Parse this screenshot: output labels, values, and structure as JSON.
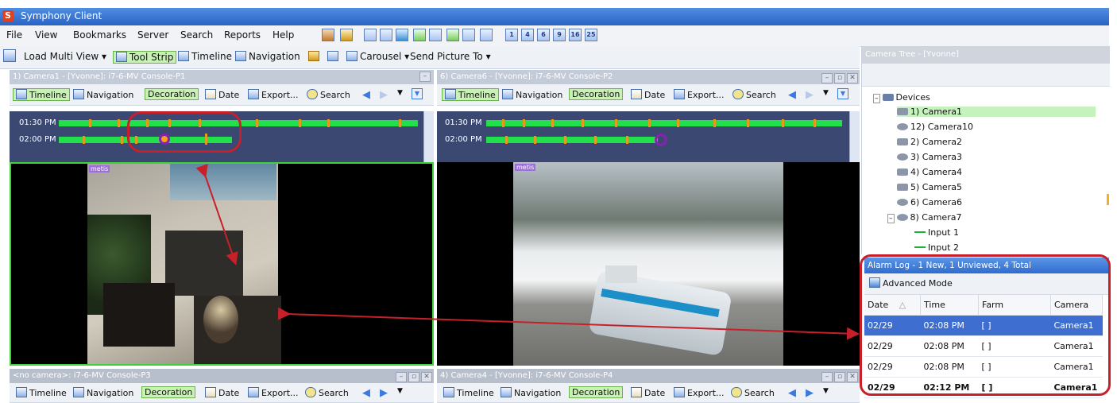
{
  "app": {
    "title": "Symphony Client",
    "logo_letter": "S"
  },
  "menu": [
    "File",
    "View",
    "Bookmarks",
    "Server",
    "Search",
    "Reports",
    "Help"
  ],
  "toolbar_numbers": [
    "1",
    "4",
    "6",
    "9",
    "16",
    "25"
  ],
  "toolbar": {
    "load_multi_view": "Load Multi View ▾",
    "tool_strip": "Tool Strip",
    "timeline": "Timeline",
    "navigation": "Navigation",
    "carousel": "Carousel ▾",
    "send_picture": "Send Picture To ▾"
  },
  "panes": {
    "p1": {
      "title": "1) Camera1 - [Yvonne]: i7-6-MV Console-P1",
      "watermark": "metis"
    },
    "p2": {
      "title": "6) Camera6 - [Yvonne]: i7-6-MV Console-P2",
      "watermark": "metis"
    },
    "p3": {
      "title": "<no camera>: i7-6-MV Console-P3"
    },
    "p4": {
      "title": "4) Camera4 - [Yvonne]: i7-6-MV Console-P4"
    }
  },
  "pane_tools": {
    "timeline": "Timeline",
    "navigation": "Navigation",
    "decoration": "Decoration",
    "date": "Date",
    "export": "Export...",
    "search": "Search"
  },
  "timeline_rows": [
    "01:30 PM",
    "02:00 PM"
  ],
  "camera_tree": {
    "header": "Camera Tree - [Yvonne]",
    "root": "Devices",
    "items": [
      "1) Camera1",
      "12) Camera10",
      "2) Camera2",
      "3) Camera3",
      "4) Camera4",
      "5) Camera5",
      "6) Camera6",
      "8) Camera7",
      "Input 1",
      "Input 2"
    ]
  },
  "alarm_log": {
    "header": "Alarm Log - 1 New, 1 Unviewed, 4 Total",
    "advanced_mode": "Advanced Mode",
    "columns": [
      "Date",
      "Time",
      "Farm",
      "Camera"
    ],
    "sort_glyph": "△",
    "rows": [
      {
        "date": "02/29",
        "time": "02:08 PM",
        "farm": "[          ]",
        "camera": "Camera1"
      },
      {
        "date": "02/29",
        "time": "02:08 PM",
        "farm": "[          ]",
        "camera": "Camera1"
      },
      {
        "date": "02/29",
        "time": "02:08 PM",
        "farm": "[          ]",
        "camera": "Camera1"
      },
      {
        "date": "02/29",
        "time": "02:12 PM",
        "farm": "[          ]",
        "camera": "Camera1"
      }
    ]
  },
  "colors": {
    "accent_red": "#c8202a",
    "timeline_green": "#22e04a",
    "selected_row": "#3e6fd0"
  }
}
